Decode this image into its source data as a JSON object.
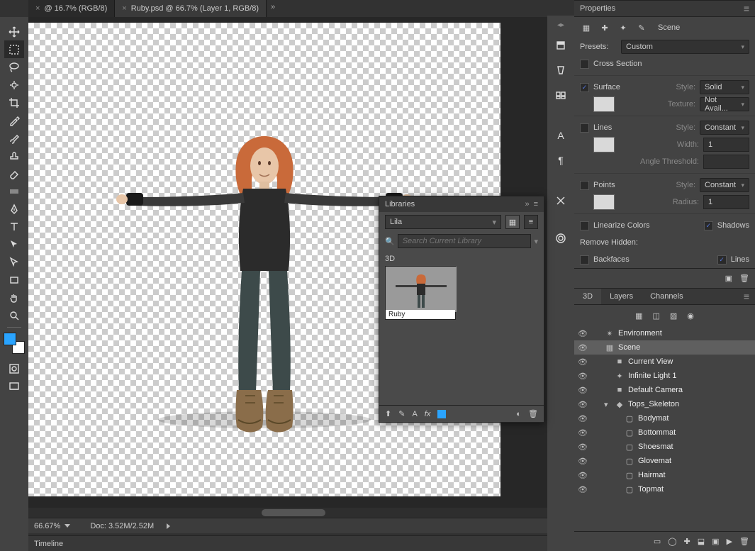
{
  "tabs": [
    {
      "label": "@ 16.7% (RGB/8)",
      "active": false
    },
    {
      "label": "Ruby.psd @ 66.7% (Layer 1, RGB/8)",
      "active": true
    }
  ],
  "status": {
    "zoom": "66.67%",
    "docinfo": "Doc: 3.52M/2.52M"
  },
  "timeline": {
    "label": "Timeline"
  },
  "properties": {
    "title": "Properties",
    "scene_label": "Scene",
    "presets_label": "Presets:",
    "presets_value": "Custom",
    "cross_section": {
      "label": "Cross Section",
      "checked": false
    },
    "surface": {
      "label": "Surface",
      "checked": true,
      "style_label": "Style:",
      "style_value": "Solid",
      "texture_label": "Texture:",
      "texture_value": "Not Avail..."
    },
    "lines": {
      "label": "Lines",
      "checked": false,
      "style_label": "Style:",
      "style_value": "Constant",
      "width_label": "Width:",
      "width_value": "1",
      "angle_label": "Angle Threshold:"
    },
    "points": {
      "label": "Points",
      "checked": false,
      "style_label": "Style:",
      "style_value": "Constant",
      "radius_label": "Radius:",
      "radius_value": "1"
    },
    "linearize": {
      "label": "Linearize Colors",
      "checked": false
    },
    "shadows": {
      "label": "Shadows",
      "checked": true
    },
    "remove_hidden": "Remove Hidden:",
    "backfaces": {
      "label": "Backfaces",
      "checked": false
    },
    "lines2": {
      "label": "Lines",
      "checked": true
    }
  },
  "panel_tabs": {
    "a": "3D",
    "b": "Layers",
    "c": "Channels"
  },
  "scene_items": [
    {
      "indent": 0,
      "icon": "env",
      "label": "Environment",
      "selected": false,
      "disclose": ""
    },
    {
      "indent": 0,
      "icon": "scene",
      "label": "Scene",
      "selected": true,
      "disclose": ""
    },
    {
      "indent": 1,
      "icon": "cam",
      "label": "Current View",
      "selected": false,
      "disclose": ""
    },
    {
      "indent": 1,
      "icon": "light",
      "label": "Infinite Light 1",
      "selected": false,
      "disclose": ""
    },
    {
      "indent": 1,
      "icon": "cam",
      "label": "Default Camera",
      "selected": false,
      "disclose": ""
    },
    {
      "indent": 1,
      "icon": "mesh",
      "label": "Tops_Skeleton",
      "selected": false,
      "disclose": "v"
    },
    {
      "indent": 2,
      "icon": "mat",
      "label": "Bodymat",
      "selected": false,
      "disclose": ""
    },
    {
      "indent": 2,
      "icon": "mat",
      "label": "Bottommat",
      "selected": false,
      "disclose": ""
    },
    {
      "indent": 2,
      "icon": "mat",
      "label": "Shoesmat",
      "selected": false,
      "disclose": ""
    },
    {
      "indent": 2,
      "icon": "mat",
      "label": "Glovemat",
      "selected": false,
      "disclose": ""
    },
    {
      "indent": 2,
      "icon": "mat",
      "label": "Hairmat",
      "selected": false,
      "disclose": ""
    },
    {
      "indent": 2,
      "icon": "mat",
      "label": "Topmat",
      "selected": false,
      "disclose": ""
    }
  ],
  "libraries": {
    "title": "Libraries",
    "dropdown": "Lila",
    "search_placeholder": "Search Current Library",
    "section": "3D",
    "thumb_caption": "Ruby"
  }
}
